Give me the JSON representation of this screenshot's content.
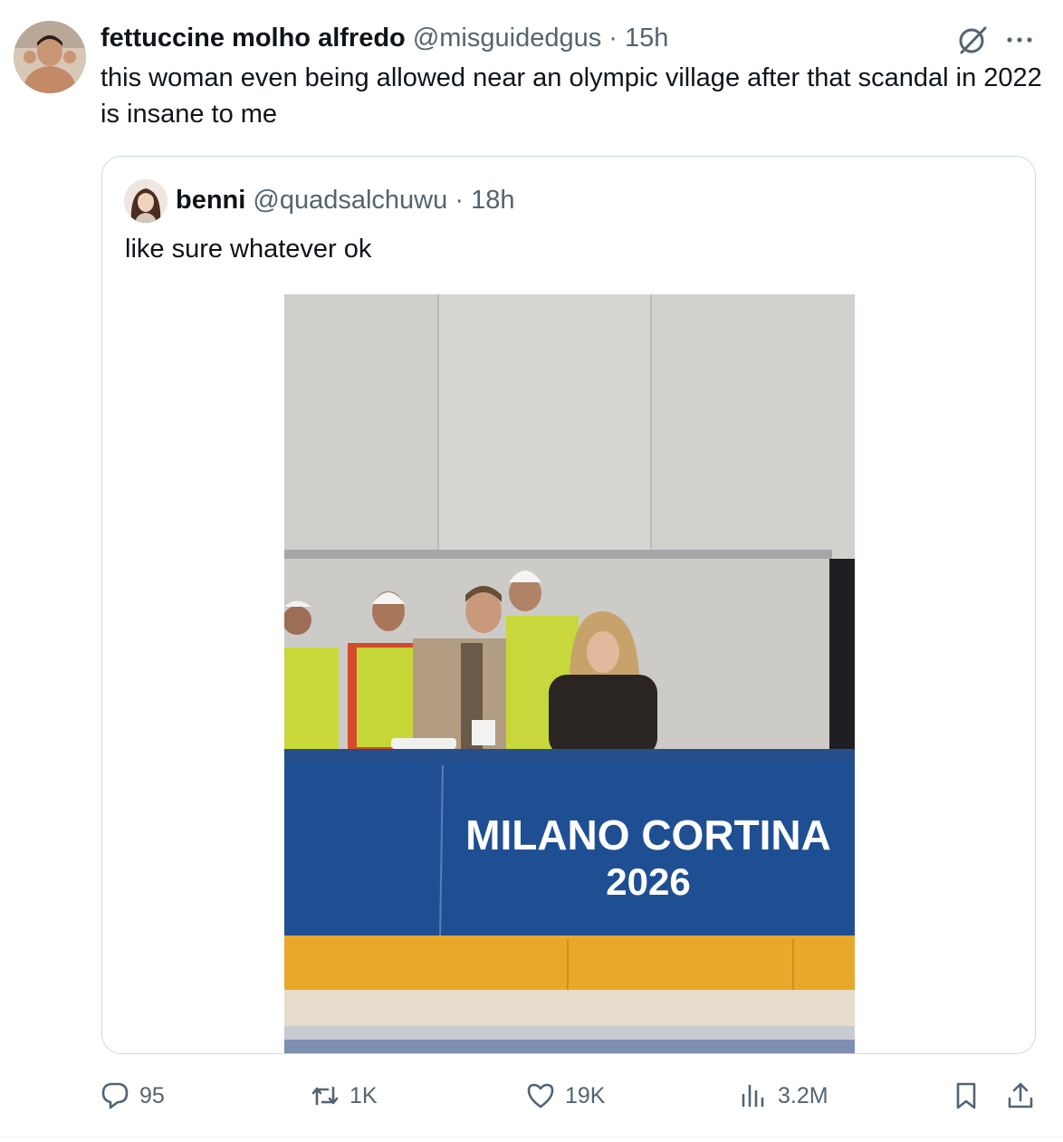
{
  "tweet": {
    "author_name": "fettuccine molho alfredo",
    "handle": "@misguidedgus",
    "separator": "·",
    "time": "15h",
    "text": "this woman even being allowed near an olympic village after that scandal in 2022 is insane to me"
  },
  "quoted_tweet": {
    "author_name": "benni",
    "handle": "@quadsalchuwu",
    "separator": "·",
    "time": "18h",
    "text": "like sure whatever ok",
    "image": {
      "banner_line1": "MILANO CORTINA",
      "banner_line2": "2026"
    }
  },
  "actions": {
    "replies": "95",
    "reposts": "1K",
    "likes": "19K",
    "views": "3.2M"
  },
  "icons": [
    "grok-icon",
    "more-icon",
    "reply-icon",
    "repost-icon",
    "like-icon",
    "views-icon",
    "bookmark-icon",
    "share-icon"
  ],
  "colors": {
    "text": "#0f1419",
    "secondary": "#536471",
    "border": "#cfd9de",
    "banner_blue": "#1f4f93",
    "rink_yellow": "#e8a82a"
  }
}
